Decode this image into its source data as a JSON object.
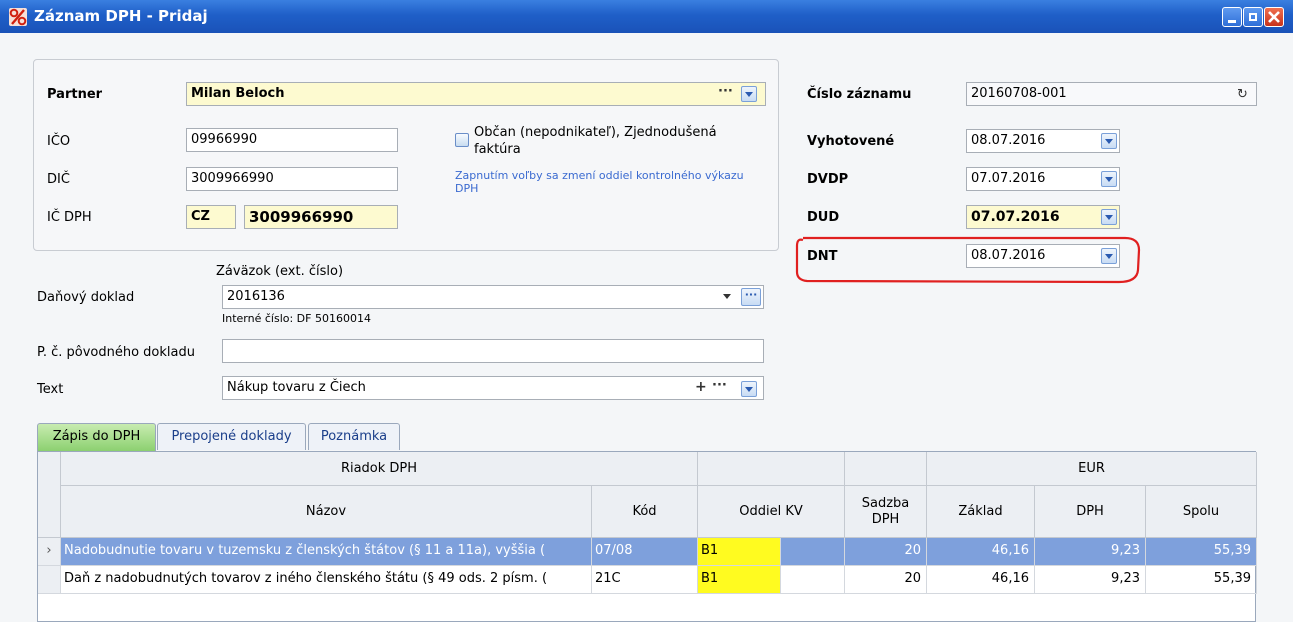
{
  "window": {
    "title": "Záznam DPH - Pridaj"
  },
  "partner": {
    "label": "Partner",
    "value": "Milan Beloch",
    "ico_label": "IČO",
    "ico": "09966990",
    "dic_label": "DIČ",
    "dic": "3009966990",
    "icdph_label": "IČ DPH",
    "icdph_country": "CZ",
    "icdph_number": "3009966990",
    "checkbox_label": "Občan (nepodnikateľ), Zjednodušená faktúra",
    "checkbox_line1": "Občan (nepodnikateľ), Zjednodušená",
    "checkbox_line2": "faktúra",
    "checkbox_checked": false,
    "note_line1": "Zapnutím voľby sa zmení oddiel kontrolného výkazu",
    "note_line2": "DPH"
  },
  "record": {
    "cislo_label": "Číslo záznamu",
    "cislo": "20160708-001",
    "vyhotovene_label": "Vyhotovené",
    "vyhotovene": "08.07.2016",
    "dvdp_label": "DVDP",
    "dvdp": "07.07.2016",
    "dud_label": "DUD",
    "dud": "07.07.2016",
    "dnt_label": "DNT",
    "dnt": "08.07.2016",
    "highlight_color": "#e02020"
  },
  "document": {
    "zavazok_label": "Záväzok (ext. číslo)",
    "danovy_label": "Daňový doklad",
    "danovy_value": "2016136",
    "interne_cislo": "Interné číslo: DF 50160014",
    "povodny_label": "P. č. pôvodného dokladu",
    "povodny_value": "",
    "text_label": "Text",
    "text_value": "Nákup tovaru z Čiech"
  },
  "tabs": [
    {
      "label": "Zápis do DPH",
      "active": true
    },
    {
      "label": "Prepojené doklady",
      "active": false
    },
    {
      "label": "Poznámka",
      "active": false
    }
  ],
  "grid": {
    "group_riadok": "Riadok DPH",
    "group_eur": "EUR",
    "columns": {
      "nazov": "Názov",
      "kod": "Kód",
      "oddiel": "Oddiel KV",
      "sadzba": "Sadzba DPH",
      "zaklad": "Základ",
      "dph": "DPH",
      "spolu": "Spolu"
    },
    "rows": [
      {
        "nazov": "Nadobudnutie tovaru v tuzemsku z členských štátov (§ 11 a 11a), vyššia (",
        "kod": "07/08",
        "oddiel": "B1",
        "sadzba": "20",
        "zaklad": "46,16",
        "dph": "9,23",
        "spolu": "55,39",
        "selected": true
      },
      {
        "nazov": "Daň z nadobudnutých tovarov z iného členského štátu (§ 49 ods. 2 písm. (",
        "kod": "21C",
        "oddiel": "B1",
        "sadzba": "20",
        "zaklad": "46,16",
        "dph": "9,23",
        "spolu": "55,39",
        "selected": false
      }
    ]
  },
  "colors": {
    "title_bar": "#1f5fc8",
    "selected_row": "#7ea0dc",
    "oddiel_highlight": "#fffb20",
    "required_field": "#fdfad0",
    "active_tab": "#8cd070"
  }
}
